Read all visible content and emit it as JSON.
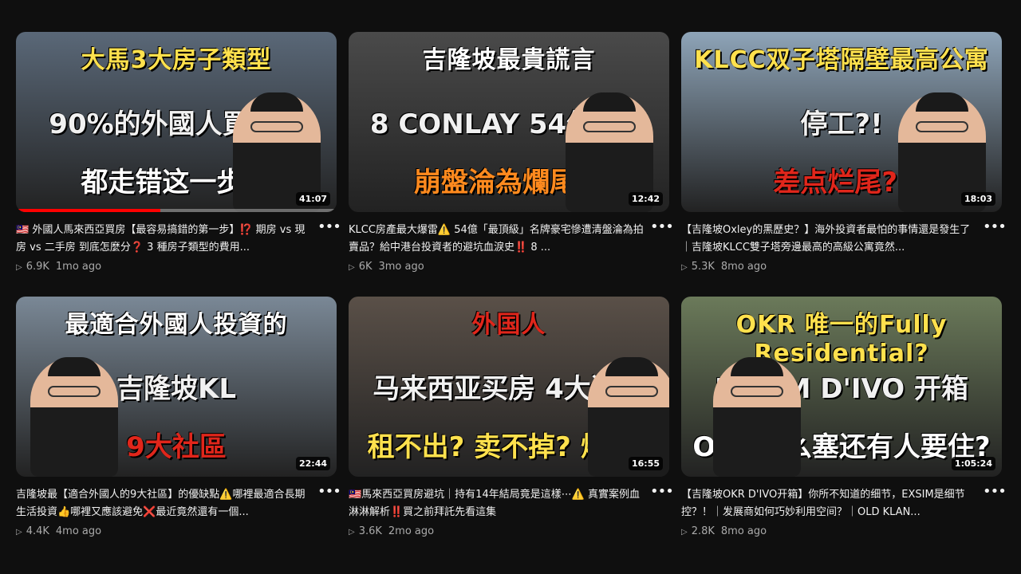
{
  "videos": [
    {
      "thumb": {
        "top": "大馬3大房子類型",
        "mid": "90%的外國人買房前",
        "bot": "都走错这一步?!",
        "bg": "#5a6878",
        "top_color": "#ffe14d",
        "bot_color": "#ffffff"
      },
      "duration": "41:07",
      "progress": 0.45,
      "title": "🇲🇾 外國人馬來西亞買房【最容易搞錯的第一步】⁉️ 期房 vs 現房 vs 二手房 到底怎麼分❓ 3 種房子類型的費用...",
      "views": "6.9K",
      "ago": "1mo ago"
    },
    {
      "thumb": {
        "top": "吉隆坡最貴謊言",
        "mid": "8 CONLAY 54億樓王",
        "bot": "崩盤淪為爛尾樓",
        "bg": "#4a4a4a",
        "top_color": "#ffffff",
        "bot_color": "#ff8a1e"
      },
      "duration": "12:42",
      "progress": 0.0,
      "title": "KLCC房產最大爆雷⚠️ 54億「最頂級」名牌豪宅慘遭清盤淪為拍賣品？給中港台投資者的避坑血淚史‼️ 8 ...",
      "views": "6K",
      "ago": "3mo ago"
    },
    {
      "thumb": {
        "top": "KLCC双子塔隔壁最高公寓",
        "mid": "停工?!",
        "bot": "差点烂尾?!",
        "bg": "#8ea4b8",
        "top_color": "#ffe14d",
        "bot_color": "#e0261b"
      },
      "duration": "18:03",
      "progress": 0.0,
      "title": "【吉隆坡Oxley的黑歷史？】海外投資者最怕的事情還是發生了｜吉隆坡KLCC雙子塔旁邊最高的高級公寓竟然...",
      "views": "5.3K",
      "ago": "8mo ago"
    },
    {
      "thumb": {
        "top": "最適合外國人投資的",
        "mid": "吉隆坡KL",
        "bot": "9大社區",
        "bg": "#7a8896",
        "top_color": "#ffffff",
        "bot_color": "#e0261b"
      },
      "duration": "22:44",
      "progress": 0.0,
      "title": "吉隆坡最【適合外國人的9大社區】的優缺點⚠️哪裡最適合長期生活投資👍哪裡又應該避免❌最近竟然還有一個...",
      "views": "4.4K",
      "ago": "4mo ago"
    },
    {
      "thumb": {
        "top": "外国人",
        "mid": "马来西亚买房 4大遗憾",
        "bot": "租不出? 卖不掉? 烂尾?",
        "bg": "#5a5048",
        "top_color": "#e0261b",
        "bot_color": "#ffe14d"
      },
      "duration": "16:55",
      "progress": 0.0,
      "title": "🇲🇾馬來西亞買房避坑｜持有14年結局竟是這樣⋯⚠️ 真實案例血淋淋解析‼️買之前拜託先看這集",
      "views": "3.6K",
      "ago": "2mo ago"
    },
    {
      "thumb": {
        "top": "OKR 唯一的Fully Residential?",
        "mid": "EXSIM D'IVO 开箱",
        "bot": "OKR这么塞还有人要住?",
        "bg": "#6b7a5a",
        "top_color": "#ffe14d",
        "bot_color": "#ffffff"
      },
      "duration": "1:05:24",
      "progress": 0.0,
      "title": "【吉隆坡OKR D'IVO开箱】你所不知道的细节，EXSIM是细节控？！｜发展商如何巧妙利用空间？｜OLD KLAN...",
      "views": "2.8K",
      "ago": "8mo ago"
    }
  ],
  "more_icon": "more-vert-icon",
  "play_icon": "play-icon",
  "more_glyph": "•••",
  "play_glyph": "▷"
}
